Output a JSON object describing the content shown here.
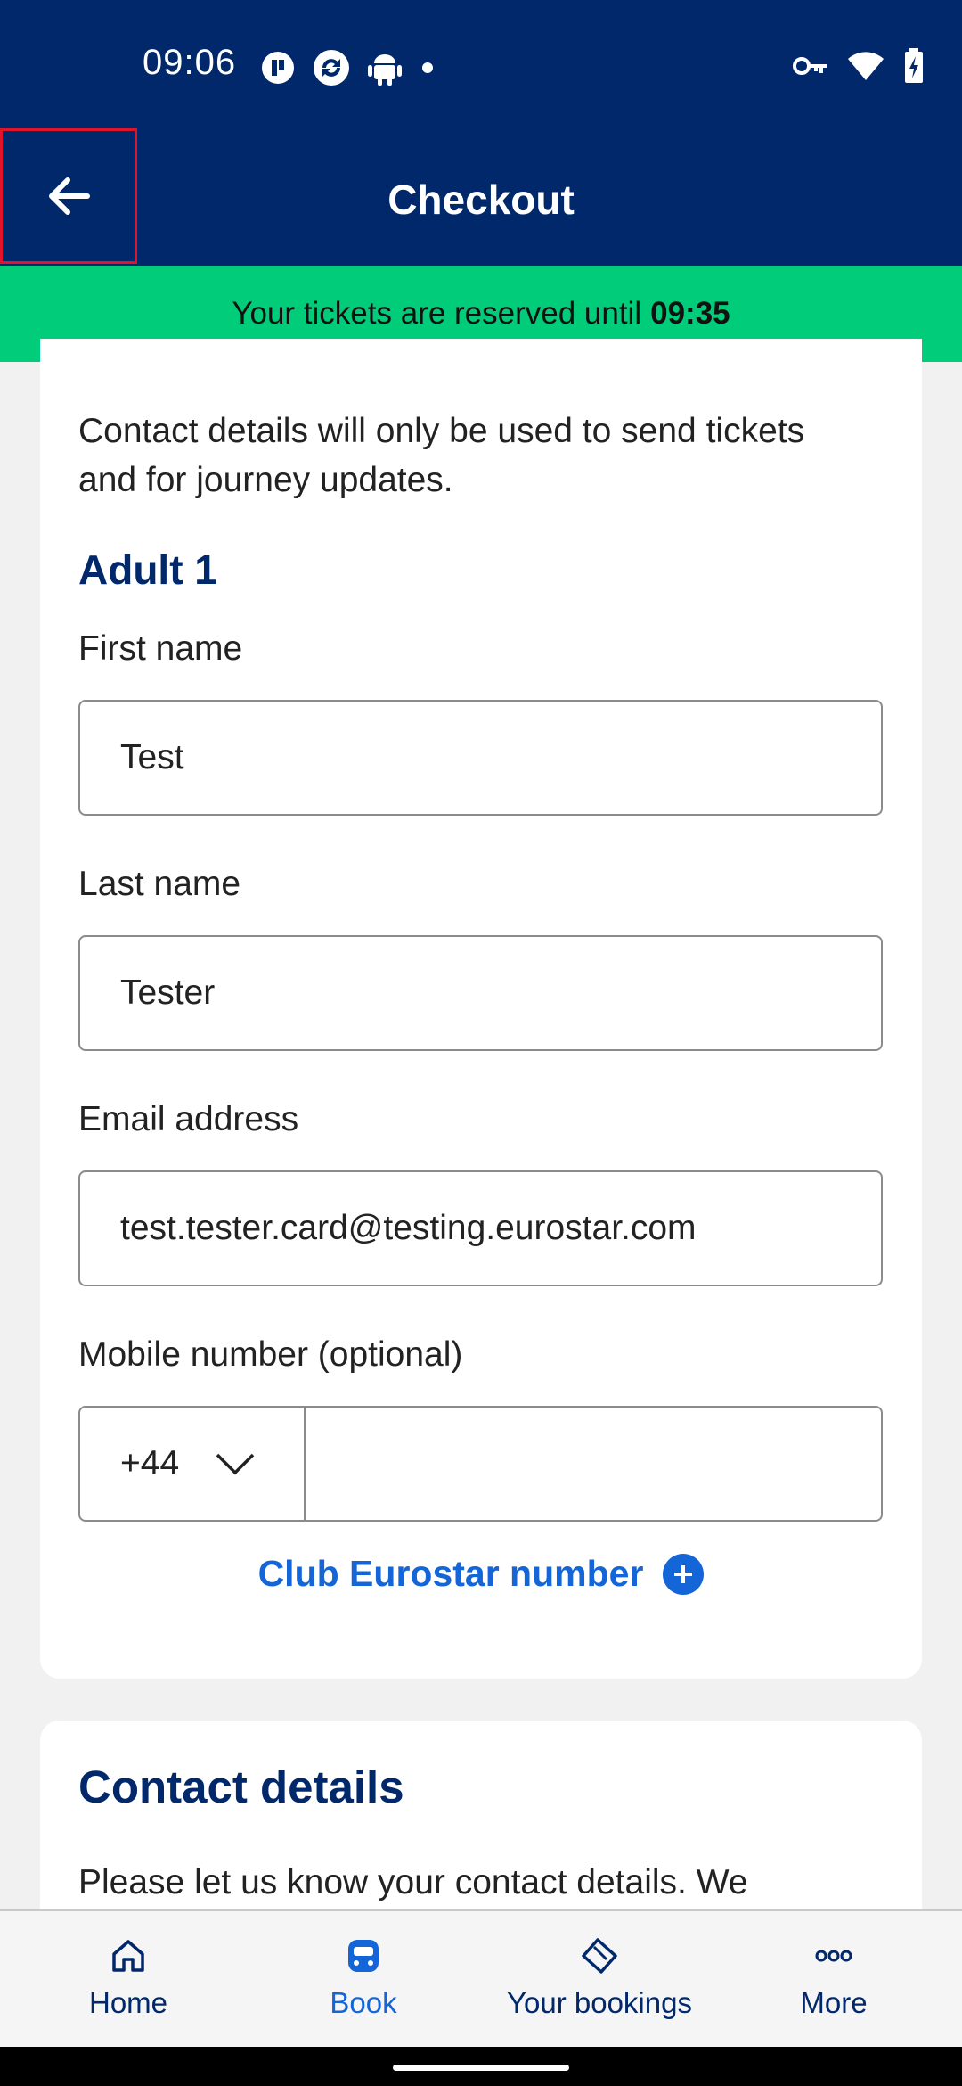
{
  "status_bar": {
    "time": "09:06",
    "left_icons": [
      "pause-circle-icon",
      "sync-icon",
      "android-icon",
      "dot-icon"
    ],
    "right_icons": [
      "key-icon",
      "wifi-icon",
      "battery-charging-icon"
    ]
  },
  "app_bar": {
    "title": "Checkout",
    "back_icon": "arrow-left-icon"
  },
  "reservation_banner": {
    "text": "Your tickets are reserved until",
    "time": "09:35",
    "color": "#00cc79"
  },
  "passenger_form": {
    "intro": "Contact details will only be used to send tickets and for journey updates.",
    "heading": "Adult 1",
    "first_name": {
      "label": "First name",
      "value": "Test"
    },
    "last_name": {
      "label": "Last name",
      "value": "Tester"
    },
    "email": {
      "label": "Email address",
      "value": "test.tester.card@testing.eurostar.com"
    },
    "mobile": {
      "label": "Mobile number (optional)",
      "country_code": "+44",
      "value": ""
    },
    "club_link": "Club Eurostar number"
  },
  "contact_section": {
    "heading": "Contact details",
    "text": "Please let us know your contact details. We"
  },
  "bottom_nav": {
    "items": [
      {
        "label": "Home",
        "icon": "home-icon",
        "active": false
      },
      {
        "label": "Book",
        "icon": "train-icon",
        "active": true
      },
      {
        "label": "Your bookings",
        "icon": "ticket-icon",
        "active": false
      },
      {
        "label": "More",
        "icon": "more-dots-icon",
        "active": false
      }
    ]
  },
  "colors": {
    "brand_navy": "#00286a",
    "accent_blue": "#1465d8",
    "banner_green": "#00cc79"
  }
}
